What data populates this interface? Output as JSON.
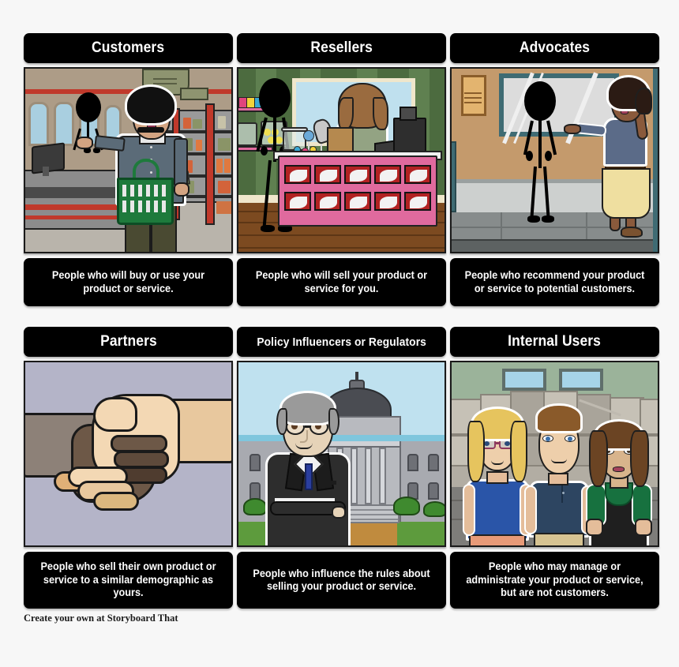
{
  "board": {
    "footer": "Create your own at Storyboard That",
    "background_color": "#f7f7f7",
    "panel_bar_color": "#000000",
    "panel_text_color": "#ffffff"
  },
  "panels": [
    {
      "title": "Customers",
      "caption": "People who will buy or use your product or service.",
      "scene": "grocery-store-checkout",
      "title_size": "normal"
    },
    {
      "title": "Resellers",
      "caption": "People who will sell your product or service for you.",
      "scene": "candy-shop-counter",
      "title_size": "normal"
    },
    {
      "title": "Advocates",
      "caption": "People who recommend your product or service to potential customers.",
      "scene": "office-hallway-whiteboard",
      "title_size": "normal"
    },
    {
      "title": "Partners",
      "caption": "People who sell their own product or service to a similar demographic as yours.",
      "scene": "handshake",
      "title_size": "normal"
    },
    {
      "title": "Policy Influencers or Regulators",
      "caption": "People who influence the rules about selling your product or service.",
      "scene": "capitol-building-official",
      "title_size": "small"
    },
    {
      "title": "Internal Users",
      "caption": "People who may manage or administrate your product or service, but are not customers.",
      "scene": "office-three-coworkers",
      "title_size": "normal"
    }
  ]
}
